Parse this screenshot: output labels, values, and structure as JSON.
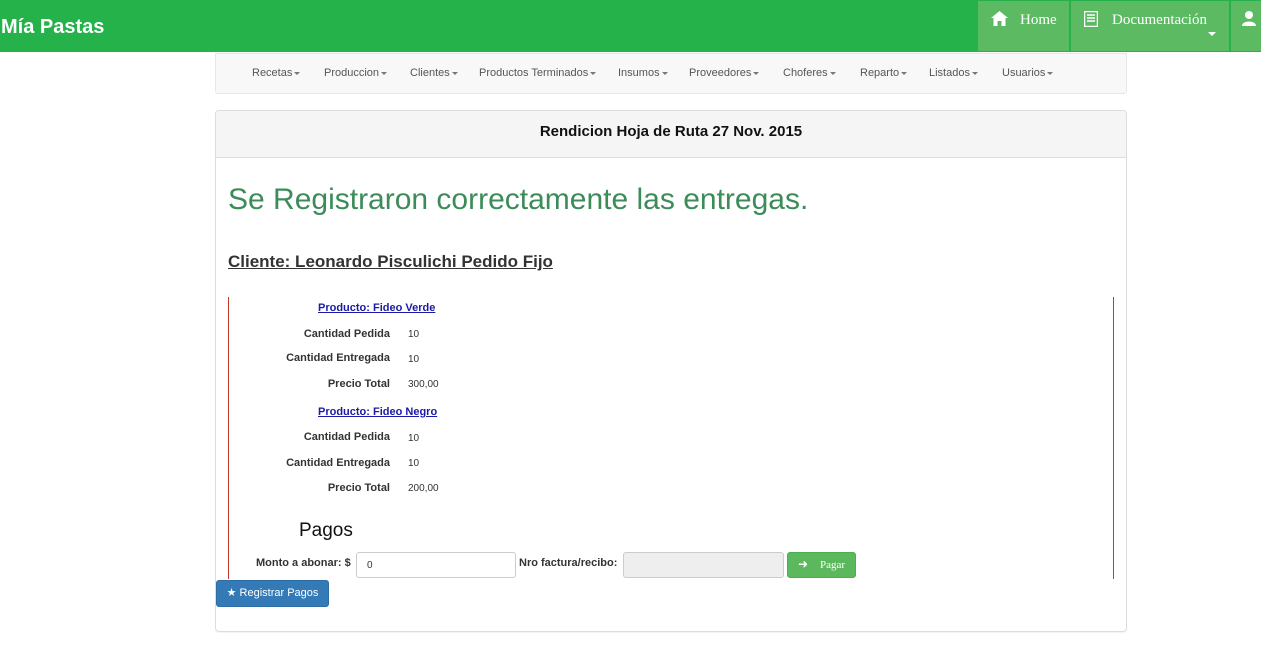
{
  "app": {
    "brand": "Mía Pastas"
  },
  "topnav": {
    "home": {
      "icon": "home-icon",
      "label": "Home"
    },
    "documentacion": {
      "icon": "document-icon",
      "label": "Documentación"
    },
    "user": {
      "icon": "user-icon"
    }
  },
  "subnav": {
    "items": [
      {
        "label": "Recetas"
      },
      {
        "label": "Produccion"
      },
      {
        "label": "Clientes"
      },
      {
        "label": "Productos Terminados"
      },
      {
        "label": "Insumos"
      },
      {
        "label": "Proveedores"
      },
      {
        "label": "Choferes"
      },
      {
        "label": "Reparto"
      },
      {
        "label": "Listados"
      },
      {
        "label": "Usuarios"
      }
    ]
  },
  "panel": {
    "title": "Rendicion Hoja de Ruta 27 Nov. 2015",
    "success_message": "Se Registraron correctamente las entregas.",
    "client_title": "Cliente: Leonardo Pisculichi Pedido Fijo",
    "products": [
      {
        "link": "Producto: Fideo Verde",
        "rows": [
          {
            "label": "Cantidad Pedida",
            "value": "10"
          },
          {
            "label": "Cantidad Entregada",
            "value": "10"
          },
          {
            "label": "Precio Total",
            "value": "300,00"
          }
        ]
      },
      {
        "link": "Producto: Fideo Negro",
        "rows": [
          {
            "label": "Cantidad Pedida",
            "value": "10"
          },
          {
            "label": "Cantidad Entregada",
            "value": "10"
          },
          {
            "label": "Precio Total",
            "value": "200,00"
          }
        ]
      }
    ],
    "pagos": {
      "title": "Pagos",
      "monto_label": "Monto a abonar: $",
      "monto_value": "0",
      "factura_label": "Nro factura/recibo:",
      "factura_value": "",
      "pagar_button": "Pagar"
    },
    "registrar_button": "★ Registrar Pagos"
  },
  "colors": {
    "topbar": "#26b24b",
    "topnav_item": "#5cbb62",
    "success_text": "#3c8c5a",
    "pagar_button": "#5cb85c",
    "registrar_button": "#337ab7",
    "separator": "#c0392b"
  }
}
